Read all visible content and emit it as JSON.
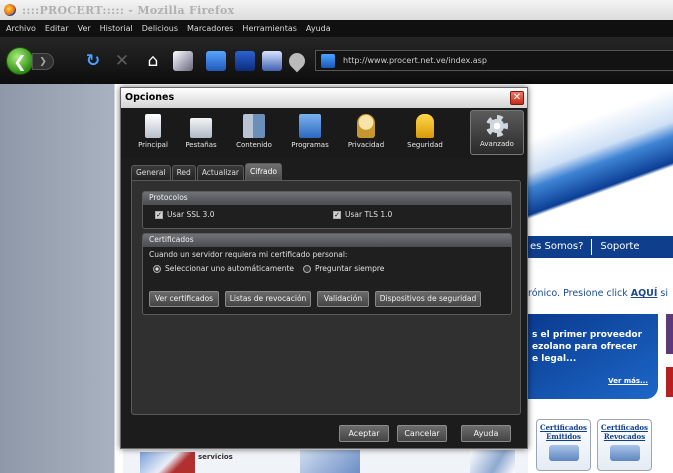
{
  "window": {
    "title": "::::PROCERT::::: - Mozilla Firefox"
  },
  "menu": [
    "Archivo",
    "Editar",
    "Ver",
    "Historial",
    "Delicious",
    "Marcadores",
    "Herramientas",
    "Ayuda"
  ],
  "navbar": {
    "url": "http://www.procert.net.ve/index.asp"
  },
  "page": {
    "nav_items": [
      "es Somos?",
      "Soporte"
    ],
    "electronic_text": "rónico. Presione click ",
    "electronic_link": "AQUÍ",
    "electronic_tail": " si",
    "promo_text": "s el primer proveedor\nezolano  para  ofrecer\ne legal...",
    "promo_more": "Ver más...",
    "cert_emitidos": "Certificados Emitidos",
    "cert_revocados": "Certificados Revocados",
    "servicios": "servicios"
  },
  "dialog": {
    "title": "Opciones",
    "panes": [
      "Principal",
      "Pestañas",
      "Contenido",
      "Programas",
      "Privacidad",
      "Seguridad",
      "Avanzado"
    ],
    "selected_pane": "Avanzado",
    "tabs": [
      "General",
      "Red",
      "Actualizar",
      "Cifrado"
    ],
    "selected_tab": "Cifrado",
    "protocols": {
      "header": "Protocolos",
      "ssl": "Usar SSL 3.0",
      "tls": "Usar TLS 1.0",
      "ssl_checked": true,
      "tls_checked": true
    },
    "certificates": {
      "header": "Certificados",
      "prompt": "Cuando un servidor requiera mi certificado personal:",
      "option_auto": "Seleccionar uno automáticamente",
      "option_ask": "Preguntar siempre",
      "selected_option": "option_auto",
      "buttons": [
        "Ver certificados",
        "Listas de revocación",
        "Validación",
        "Dispositivos de seguridad"
      ]
    },
    "footer": {
      "accept": "Aceptar",
      "cancel": "Cancelar",
      "help": "Ayuda"
    }
  }
}
